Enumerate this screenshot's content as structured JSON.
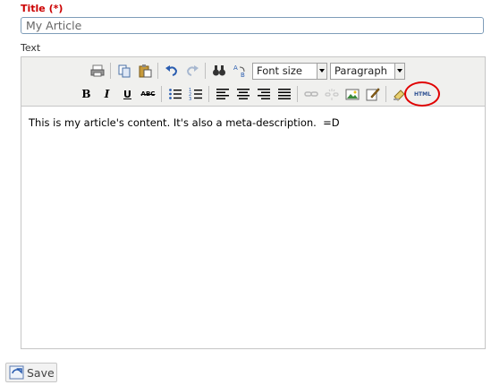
{
  "form": {
    "title_label": "Title (*)",
    "title_value": "My Article",
    "text_label": "Text"
  },
  "toolbar": {
    "row1": [
      "print-icon",
      "copy-icon",
      "paste-icon",
      "undo-icon",
      "redo-icon",
      "find-icon",
      "replace-icon"
    ],
    "font_size_select": "Font size",
    "format_select": "Paragraph",
    "row2": [
      "bold",
      "italic",
      "underline",
      "strikethrough",
      "bullet-list",
      "numbered-list",
      "align-left",
      "align-center",
      "align-right",
      "align-justify",
      "link",
      "unlink",
      "image",
      "edit",
      "cleanup",
      "html"
    ],
    "bold_label": "B",
    "italic_label": "I",
    "underline_label": "U",
    "strike_label": "ABC",
    "html_label": "HTML"
  },
  "editor": {
    "content": "This is my article's content. It's also a meta-description.  =D"
  },
  "actions": {
    "save_label": "Save"
  },
  "colors": {
    "required_label": "#cc0000",
    "toolbar_bg": "#f0f0ee",
    "annotation_ring": "#e00000"
  }
}
